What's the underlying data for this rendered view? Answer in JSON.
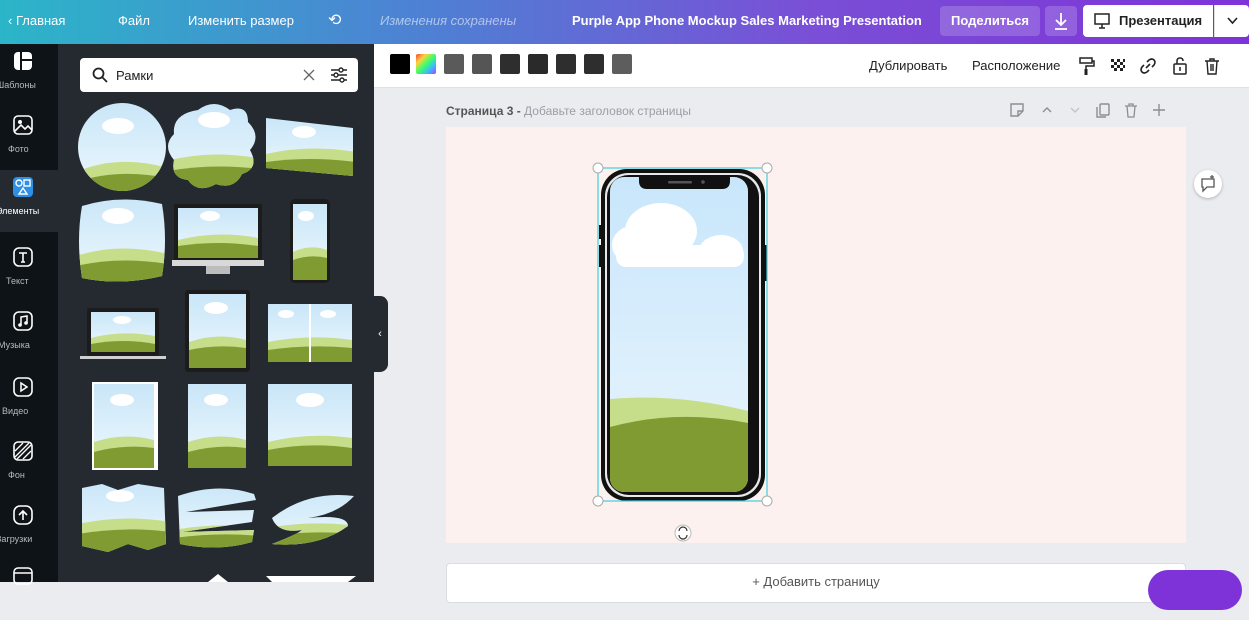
{
  "topbar": {
    "home": "Главная",
    "file": "Файл",
    "resize": "Изменить размер",
    "saved": "Изменения сохранены",
    "doc_title": "Purple App Phone Mockup Sales Marketing Presentation",
    "share": "Поделиться",
    "present": "Презентация"
  },
  "rail": {
    "items": [
      {
        "label": "Шаблоны",
        "icon": "templates-icon"
      },
      {
        "label": "Фото",
        "icon": "photo-icon"
      },
      {
        "label": "Элементы",
        "icon": "elements-icon"
      },
      {
        "label": "Текст",
        "icon": "text-icon"
      },
      {
        "label": "Музыка",
        "icon": "music-icon"
      },
      {
        "label": "Видео",
        "icon": "video-icon"
      },
      {
        "label": "Фон",
        "icon": "background-icon"
      },
      {
        "label": "Загрузки",
        "icon": "uploads-icon"
      }
    ]
  },
  "panel": {
    "search_value": "Рамки"
  },
  "toolbar": {
    "swatches": [
      "#000000",
      "rainbow",
      "#5a5a5a",
      "#555555",
      "#2e2e2e",
      "#2a2a2a",
      "#2e2e2e",
      "#2e2e2e",
      "#3a3a3a",
      "#5d5d5d"
    ],
    "duplicate": "Дублировать",
    "arrange": "Расположение"
  },
  "page": {
    "label": "Страница 3 - ",
    "subtitle": "Добавьте заголовок страницы",
    "add_page": "+ Добавить страницу"
  },
  "colors": {
    "accent": "#7d33d8",
    "selection": "#3fd0dc",
    "hill_dark": "#7f9b31",
    "hill_light": "#c6dd8a",
    "sky": "#d6eefc"
  }
}
